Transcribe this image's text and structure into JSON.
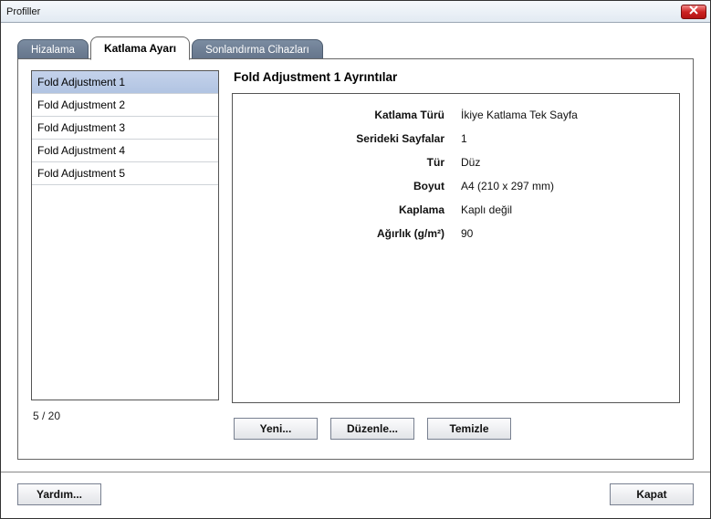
{
  "window": {
    "title": "Profiller"
  },
  "tabs": {
    "alignment": "Hizalama",
    "fold": "Katlama Ayarı",
    "finishing": "Sonlandırma Cihazları"
  },
  "list": {
    "items": [
      "Fold Adjustment 1",
      "Fold Adjustment 2",
      "Fold Adjustment 3",
      "Fold Adjustment 4",
      "Fold Adjustment 5"
    ],
    "counter": "5 / 20"
  },
  "details": {
    "title": "Fold Adjustment 1 Ayrıntılar",
    "rows": [
      {
        "label": "Katlama Türü",
        "value": "İkiye Katlama Tek Sayfa"
      },
      {
        "label": "Serideki Sayfalar",
        "value": "1"
      },
      {
        "label": "Tür",
        "value": "Düz"
      },
      {
        "label": "Boyut",
        "value": "A4 (210 x 297 mm)"
      },
      {
        "label": "Kaplama",
        "value": "Kaplı değil"
      },
      {
        "label": "Ağırlık (g/m²)",
        "value": "90"
      }
    ]
  },
  "buttons": {
    "new": "Yeni...",
    "edit": "Düzenle...",
    "clear": "Temizle",
    "help": "Yardım...",
    "close": "Kapat"
  }
}
